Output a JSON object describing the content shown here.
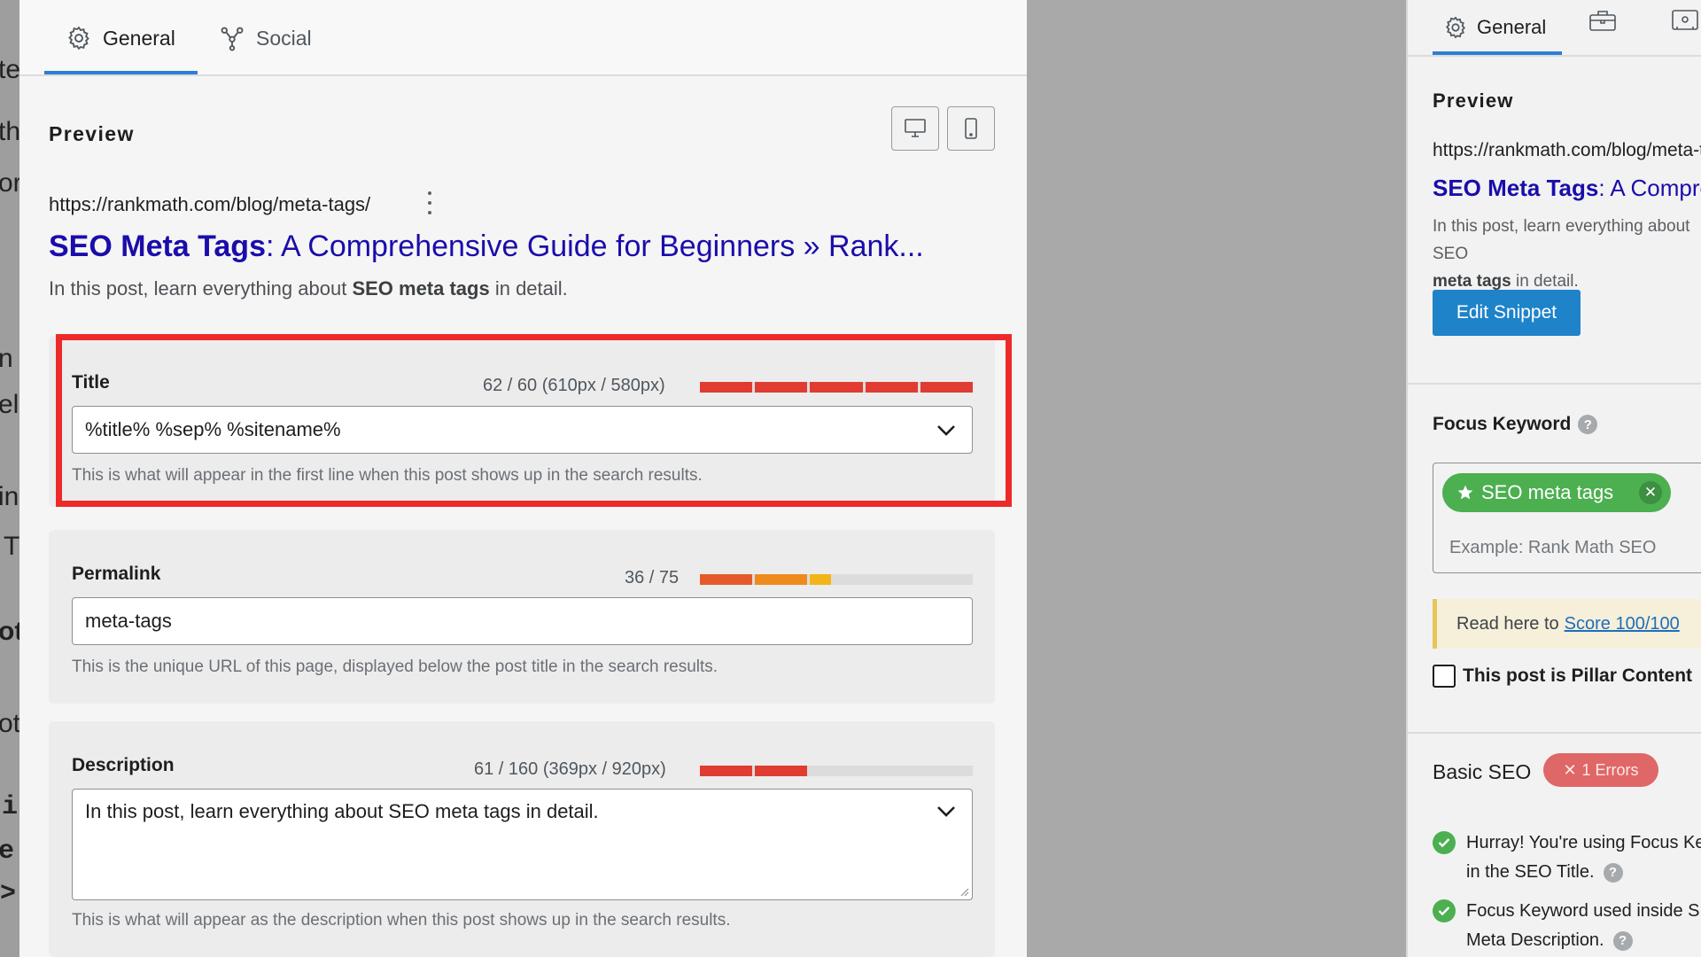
{
  "background_editor": {
    "fragments": [
      "te",
      "th",
      "or",
      "n I",
      "ell",
      "in",
      "T",
      "oti",
      "ot",
      "i",
      "e.",
      ">"
    ]
  },
  "modal": {
    "tabs": [
      {
        "label": "General",
        "icon": "gear-icon",
        "active": true
      },
      {
        "label": "Social",
        "icon": "social-share-icon",
        "active": false
      }
    ],
    "preview": {
      "heading": "Preview",
      "devices": [
        {
          "icon": "desktop-icon",
          "active": true
        },
        {
          "icon": "mobile-icon",
          "active": false
        }
      ],
      "serp": {
        "url": "https://rankmath.com/blog/meta-tags/",
        "title_keyword": "SEO Meta Tags",
        "title_rest": ": A Comprehensive Guide for Beginners » Rank...",
        "desc_before": "In this post, learn everything about ",
        "desc_keyword": "SEO meta tags",
        "desc_after": " in detail."
      }
    },
    "fields": {
      "title": {
        "label": "Title",
        "count": "62 / 60 (610px / 580px)",
        "meter_fill": 1.0,
        "meter_color": "#e03c31",
        "value": "%title% %sep% %sitename%",
        "help": "This is what will appear in the first line when this post shows up in the search results."
      },
      "permalink": {
        "label": "Permalink",
        "count": "36 / 75",
        "meter_fill": 0.48,
        "meter_colors": [
          "#e55a2b",
          "#ee8a1e",
          "#f2b418"
        ],
        "value": "meta-tags",
        "help": "This is the unique URL of this page, displayed below the post title in the search results."
      },
      "description": {
        "label": "Description",
        "count": "61 / 160 (369px / 920px)",
        "meter_fill": 0.4,
        "meter_color": "#e03c31",
        "value": "In this post, learn everything about SEO meta tags in detail.",
        "help": "This is what will appear as the description when this post shows up in the search results."
      }
    }
  },
  "sidebar": {
    "tabs": [
      {
        "label": "General",
        "icon": "gear-icon",
        "active": true
      },
      {
        "label": "",
        "icon": "toolbox-icon",
        "active": false
      },
      {
        "label": "",
        "icon": "schema-icon",
        "active": false
      }
    ],
    "preview": {
      "heading": "Preview",
      "url": "https://rankmath.com/blog/meta-tags/",
      "title_keyword": "SEO Meta Tags",
      "title_rest": ": A Comprehensive Guide for Beginners",
      "desc_before": "In this post, learn everything about ",
      "desc_keyword": "meta tags",
      "desc_after": " in detail.",
      "desc_prefix_keyword": "SEO",
      "edit_button": "Edit Snippet"
    },
    "focus_keyword": {
      "label": "Focus Keyword",
      "chip": "SEO meta tags",
      "placeholder": "Example: Rank Math SEO"
    },
    "notice": {
      "text": "Read here to",
      "link": "Score 100/100"
    },
    "pillar_label": "This post is Pillar Content",
    "basic_seo": {
      "heading": "Basic SEO",
      "badge": "1 Errors",
      "checks": [
        {
          "line1": "Hurray! You're using Focus Keyword",
          "line2": "in the SEO Title."
        },
        {
          "line1": "Focus Keyword used inside SEO",
          "line2": "Meta Description."
        }
      ]
    }
  },
  "colors": {
    "accent": "#2b7fd6",
    "serp_link": "#1a0dab",
    "highlight_border": "#ed2a2a",
    "success": "#4caf50",
    "error_badge": "#e06767",
    "button": "#1e83c9"
  }
}
